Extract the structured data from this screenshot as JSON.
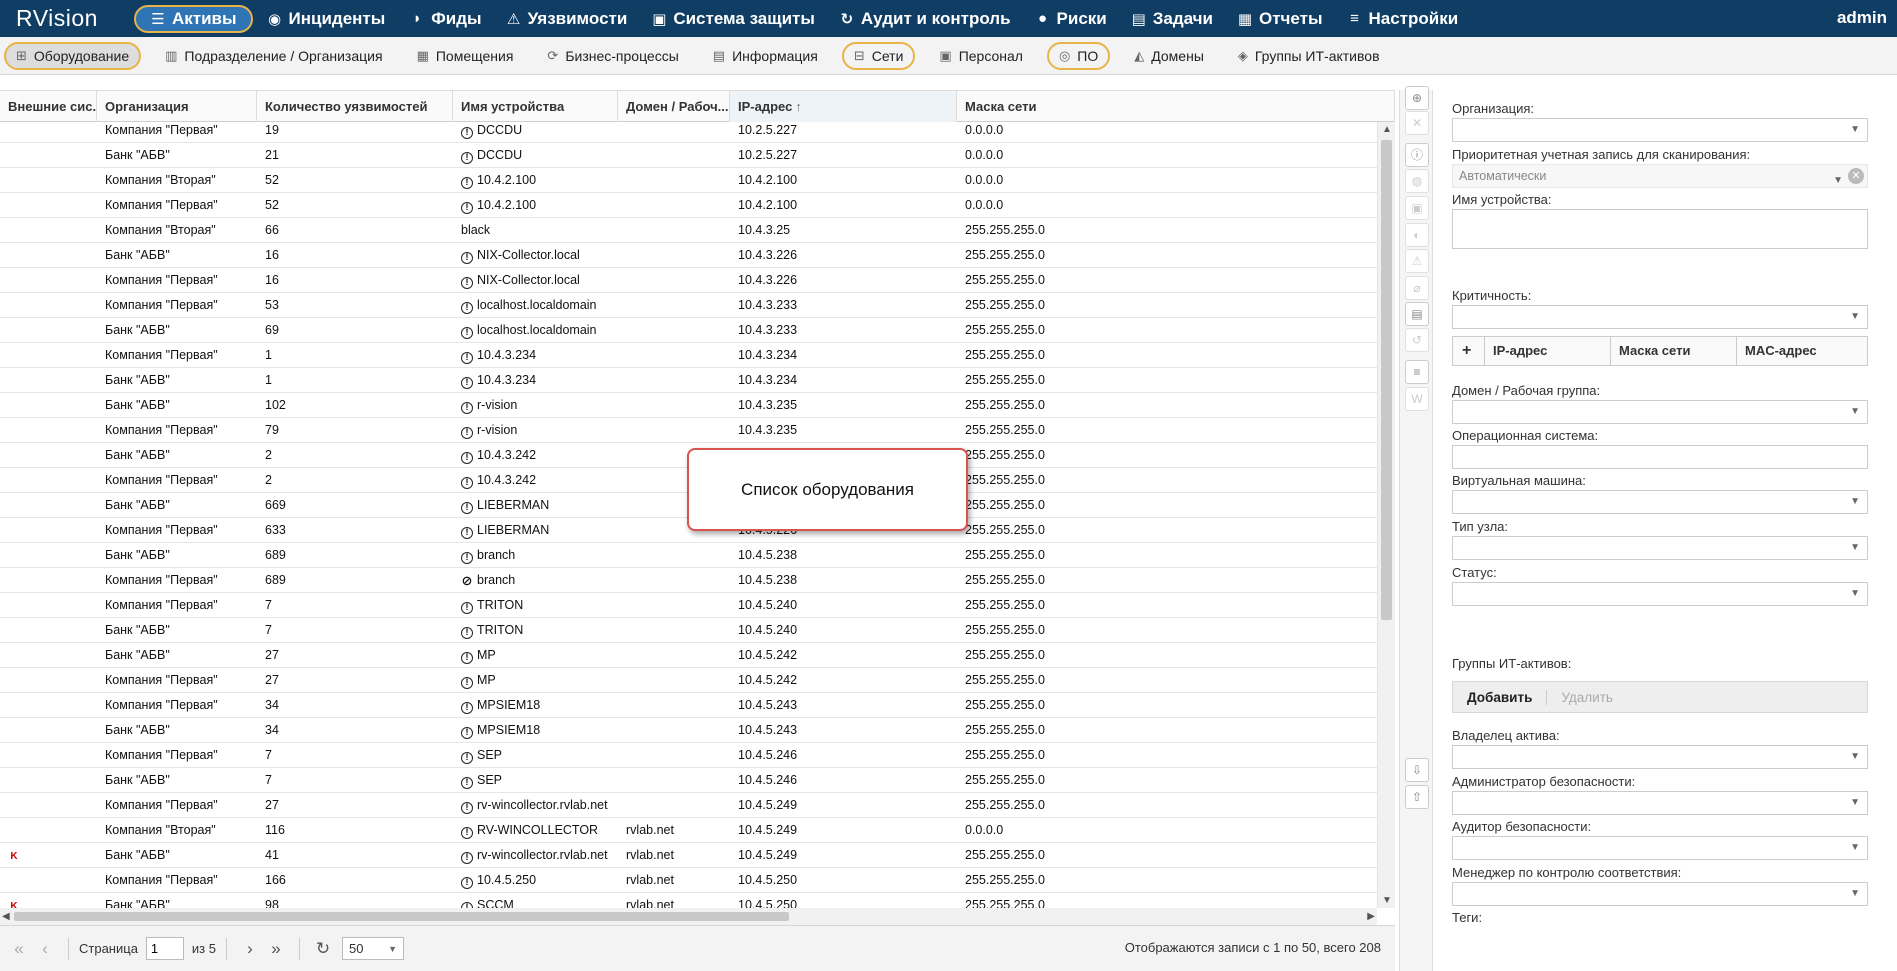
{
  "app": {
    "logo": "RVision",
    "user": "admin"
  },
  "topnav": [
    {
      "label": "Активы",
      "icon": "database-icon",
      "glyph": "☰",
      "active": true
    },
    {
      "label": "Инциденты",
      "icon": "target-icon",
      "glyph": "◉"
    },
    {
      "label": "Фиды",
      "icon": "rss-icon",
      "glyph": "◗"
    },
    {
      "label": "Уязвимости",
      "icon": "warning-icon",
      "glyph": "⚠"
    },
    {
      "label": "Система защиты",
      "icon": "shield-icon",
      "glyph": "▣"
    },
    {
      "label": "Аудит и контроль",
      "icon": "refresh-icon",
      "glyph": "↻"
    },
    {
      "label": "Риски",
      "icon": "alert-circle-icon",
      "glyph": "●"
    },
    {
      "label": "Задачи",
      "icon": "tasks-icon",
      "glyph": "▤"
    },
    {
      "label": "Отчеты",
      "icon": "book-icon",
      "glyph": "▦"
    },
    {
      "label": "Настройки",
      "icon": "menu-icon",
      "glyph": "≡"
    }
  ],
  "subnav": [
    {
      "label": "Оборудование",
      "icon": "network-icon",
      "glyph": "⊞",
      "active": true,
      "hl": true
    },
    {
      "label": "Подразделение / Организация",
      "icon": "org-icon",
      "glyph": "▥"
    },
    {
      "label": "Помещения",
      "icon": "building-icon",
      "glyph": "▦"
    },
    {
      "label": "Бизнес-процессы",
      "icon": "process-icon",
      "glyph": "⟳"
    },
    {
      "label": "Информация",
      "icon": "document-icon",
      "glyph": "▤"
    },
    {
      "label": "Сети",
      "icon": "lan-icon",
      "glyph": "⊟",
      "hl": true
    },
    {
      "label": "Персонал",
      "icon": "badge-icon",
      "glyph": "▣"
    },
    {
      "label": "ПО",
      "icon": "disc-icon",
      "glyph": "◎",
      "hl": true
    },
    {
      "label": "Домены",
      "icon": "domain-icon",
      "glyph": "◭"
    },
    {
      "label": "Группы ИТ-активов",
      "icon": "layers-icon",
      "glyph": "◈"
    }
  ],
  "table": {
    "columns": [
      "Внешние сис...",
      "Организация",
      "Количество уязвимостей",
      "Имя устройства",
      "Домен / Рабоч...",
      "IP-адрес",
      "Маска сети"
    ],
    "sort_arrow": "↑",
    "rows": [
      [
        "",
        "Компания \"Первая\"",
        "19",
        "DCCDU",
        "",
        "10.2.5.227",
        "0.0.0.0",
        "!"
      ],
      [
        "",
        "Банк \"АБВ\"",
        "21",
        "DCCDU",
        "",
        "10.2.5.227",
        "0.0.0.0",
        "!"
      ],
      [
        "",
        "Компания \"Вторая\"",
        "52",
        "10.4.2.100",
        "",
        "10.4.2.100",
        "0.0.0.0",
        "!"
      ],
      [
        "",
        "Компания \"Первая\"",
        "52",
        "10.4.2.100",
        "",
        "10.4.2.100",
        "0.0.0.0",
        "!"
      ],
      [
        "",
        "Компания \"Вторая\"",
        "66",
        "black",
        "",
        "10.4.3.25",
        "255.255.255.0",
        ""
      ],
      [
        "",
        "Банк \"АБВ\"",
        "16",
        "NIX-Collector.local",
        "",
        "10.4.3.226",
        "255.255.255.0",
        "!"
      ],
      [
        "",
        "Компания \"Первая\"",
        "16",
        "NIX-Collector.local",
        "",
        "10.4.3.226",
        "255.255.255.0",
        "!"
      ],
      [
        "",
        "Компания \"Первая\"",
        "53",
        "localhost.localdomain",
        "",
        "10.4.3.233",
        "255.255.255.0",
        "!"
      ],
      [
        "",
        "Банк \"АБВ\"",
        "69",
        "localhost.localdomain",
        "",
        "10.4.3.233",
        "255.255.255.0",
        "!"
      ],
      [
        "",
        "Компания \"Первая\"",
        "1",
        "10.4.3.234",
        "",
        "10.4.3.234",
        "255.255.255.0",
        "!"
      ],
      [
        "",
        "Банк \"АБВ\"",
        "1",
        "10.4.3.234",
        "",
        "10.4.3.234",
        "255.255.255.0",
        "!"
      ],
      [
        "",
        "Банк \"АБВ\"",
        "102",
        "r-vision",
        "",
        "10.4.3.235",
        "255.255.255.0",
        "!"
      ],
      [
        "",
        "Компания \"Первая\"",
        "79",
        "r-vision",
        "",
        "10.4.3.235",
        "255.255.255.0",
        "!"
      ],
      [
        "",
        "Банк \"АБВ\"",
        "2",
        "10.4.3.242",
        "",
        "",
        "255.255.255.0",
        "!"
      ],
      [
        "",
        "Компания \"Первая\"",
        "2",
        "10.4.3.242",
        "",
        "",
        "255.255.255.0",
        "!"
      ],
      [
        "",
        "Банк \"АБВ\"",
        "669",
        "LIEBERMAN",
        "",
        "",
        "255.255.255.0",
        "!"
      ],
      [
        "",
        "Компания \"Первая\"",
        "633",
        "LIEBERMAN",
        "",
        "10.4.5.226",
        "255.255.255.0",
        "!"
      ],
      [
        "",
        "Банк \"АБВ\"",
        "689",
        "branch",
        "",
        "10.4.5.238",
        "255.255.255.0",
        "!"
      ],
      [
        "",
        "Компания \"Первая\"",
        "689",
        "branch",
        "",
        "10.4.5.238",
        "255.255.255.0",
        "⊘"
      ],
      [
        "",
        "Компания \"Первая\"",
        "7",
        "TRITON",
        "",
        "10.4.5.240",
        "255.255.255.0",
        "!"
      ],
      [
        "",
        "Банк \"АБВ\"",
        "7",
        "TRITON",
        "",
        "10.4.5.240",
        "255.255.255.0",
        "!"
      ],
      [
        "",
        "Банк \"АБВ\"",
        "27",
        "MP",
        "",
        "10.4.5.242",
        "255.255.255.0",
        "!"
      ],
      [
        "",
        "Компания \"Первая\"",
        "27",
        "MP",
        "",
        "10.4.5.242",
        "255.255.255.0",
        "!"
      ],
      [
        "",
        "Компания \"Первая\"",
        "34",
        "MPSIEM18",
        "",
        "10.4.5.243",
        "255.255.255.0",
        "!"
      ],
      [
        "",
        "Банк \"АБВ\"",
        "34",
        "MPSIEM18",
        "",
        "10.4.5.243",
        "255.255.255.0",
        "!"
      ],
      [
        "",
        "Компания \"Первая\"",
        "7",
        "SEP",
        "",
        "10.4.5.246",
        "255.255.255.0",
        "!"
      ],
      [
        "",
        "Банк \"АБВ\"",
        "7",
        "SEP",
        "",
        "10.4.5.246",
        "255.255.255.0",
        "!"
      ],
      [
        "",
        "Компания \"Первая\"",
        "27",
        "rv-wincollector.rvlab.net",
        "",
        "10.4.5.249",
        "255.255.255.0",
        "!"
      ],
      [
        "",
        "Компания \"Вторая\"",
        "116",
        "RV-WINCOLLECTOR",
        "rvlab.net",
        "10.4.5.249",
        "0.0.0.0",
        "!"
      ],
      [
        "K",
        "Банк \"АБВ\"",
        "41",
        "rv-wincollector.rvlab.net",
        "rvlab.net",
        "10.4.5.249",
        "255.255.255.0",
        "!"
      ],
      [
        "",
        "Компания \"Первая\"",
        "166",
        "10.4.5.250",
        "rvlab.net",
        "10.4.5.250",
        "255.255.255.0",
        "!"
      ],
      [
        "K",
        "Банк \"АБВ\"",
        "98",
        "SCCM",
        "rvlab.net",
        "10.4.5.250",
        "255.255.255.0",
        "!"
      ]
    ]
  },
  "pager": {
    "first": "«",
    "prev": "‹",
    "next": "›",
    "last": "»",
    "page_label": "Страница",
    "page_value": "1",
    "of_label": "из 5",
    "refresh": "↻",
    "page_size": "50",
    "info": "Отображаются записи с 1 по 50, всего 208"
  },
  "callout": "Список оборудования",
  "toolbar": [
    {
      "icon": "add-icon",
      "glyph": "⊕",
      "dim": false
    },
    {
      "icon": "delete-icon",
      "glyph": "✕",
      "dim": true
    },
    {
      "icon": "info-icon",
      "glyph": "ⓘ",
      "dim": false
    },
    {
      "icon": "scan-icon",
      "glyph": "◍",
      "dim": true
    },
    {
      "icon": "card-icon",
      "glyph": "▣",
      "dim": true
    },
    {
      "icon": "shield-icon",
      "glyph": "◐",
      "dim": true
    },
    {
      "icon": "warning-icon",
      "glyph": "⚠",
      "dim": true
    },
    {
      "icon": "attach-icon",
      "glyph": "⌀",
      "dim": true
    },
    {
      "icon": "clipboard-icon",
      "glyph": "▤",
      "dim": false
    },
    {
      "icon": "history-icon",
      "glyph": "↺",
      "dim": true
    },
    {
      "icon": "list-icon",
      "glyph": "≡",
      "dim": false
    },
    {
      "icon": "word-icon",
      "glyph": "W",
      "dim": true
    },
    {
      "icon": "import-icon",
      "glyph": "⇩",
      "dim": false
    },
    {
      "icon": "export-icon",
      "glyph": "⇧",
      "dim": false
    }
  ],
  "form": {
    "org_label": "Организация:",
    "scan_label": "Приоритетная учетная запись для сканирования:",
    "scan_value": "Автоматически",
    "device_label": "Имя устройства:",
    "crit_label": "Критичность:",
    "ip_cols": [
      "IP-адрес",
      "Маска сети",
      "MAC-адрес"
    ],
    "domain_label": "Домен / Рабочая группа:",
    "os_label": "Операционная система:",
    "vm_label": "Виртуальная машина:",
    "node_label": "Тип узла:",
    "status_label": "Статус:",
    "groups_label": "Группы ИТ-активов:",
    "add_btn": "Добавить",
    "remove_btn": "Удалить",
    "owner_label": "Владелец актива:",
    "secadmin_label": "Администратор безопасности:",
    "auditor_label": "Аудитор безопасности:",
    "compliance_label": "Менеджер по контролю соответствия:",
    "tags_label": "Теги:"
  }
}
